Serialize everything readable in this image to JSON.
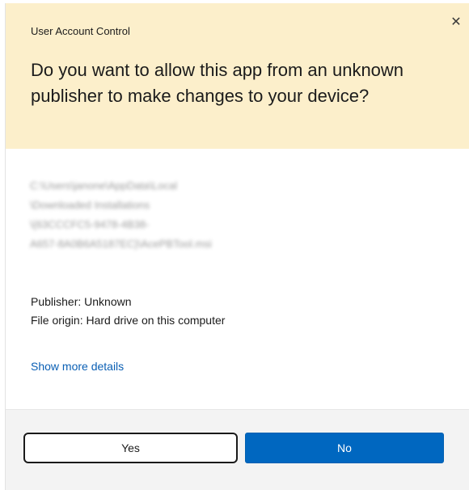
{
  "dialog": {
    "title": "User Account Control",
    "close_glyph": "✕",
    "question": "Do you want to allow this app from an unknown publisher to make changes to your device?",
    "path_lines": [
      "C:\\Users\\janone\\AppData\\Local",
      "\\Downloaded Installations",
      "\\{63CCCFC5-9478-4B38-",
      "A657-8A0B6A5187EC}\\AcePBTool.msi"
    ],
    "publisher": "Publisher: Unknown",
    "file_origin": "File origin: Hard drive on this computer",
    "details_link": "Show more details",
    "buttons": {
      "yes": "Yes",
      "no": "No"
    }
  },
  "colors": {
    "header_bg": "#fcefcb",
    "accent": "#0067c0",
    "link": "#0a5fb4",
    "footer_bg": "#f3f3f3"
  },
  "icons": {
    "close": "close-icon"
  }
}
